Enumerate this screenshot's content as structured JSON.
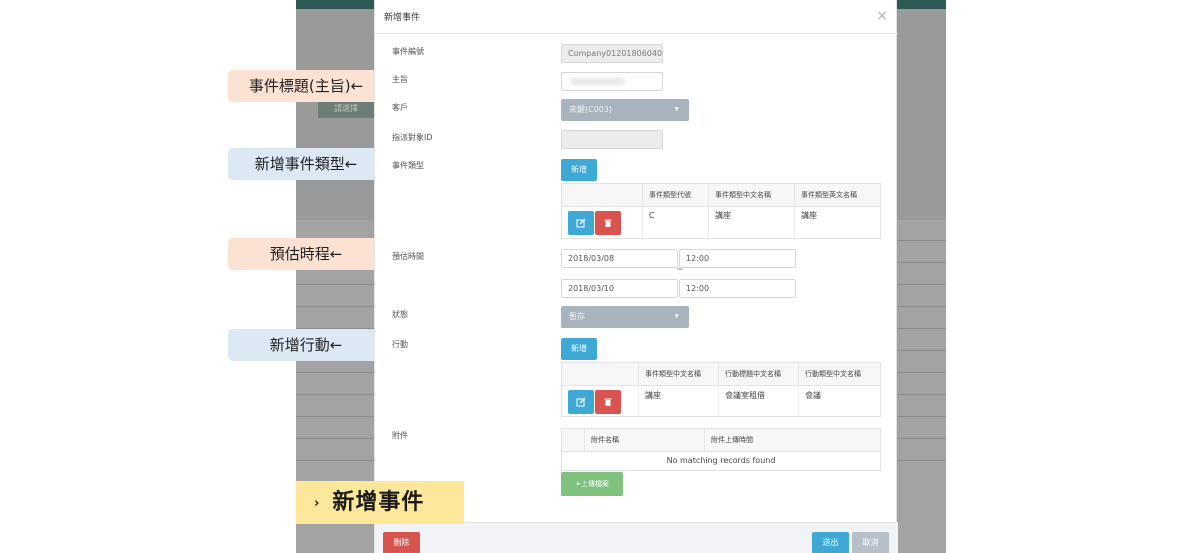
{
  "background": {
    "button_label": "請選擇"
  },
  "callouts": {
    "subject": "事件標題(主旨)←",
    "event_type": "新增事件類型←",
    "estimated_time": "預估時程←",
    "action": "新增行動←"
  },
  "banner": {
    "chevron": "›",
    "text": "新增事件"
  },
  "modal": {
    "title": "新增事件",
    "close_glyph": "×",
    "fields": {
      "event_number_label": "事件編號",
      "event_number_value": "Company01201806040",
      "subject_label": "主旨",
      "customer_label": "客戶",
      "customer_value": "來鍵(C003)",
      "assignee_label": "指派對象ID",
      "event_type_label": "事件類型",
      "estimated_time_label": "預估時間",
      "start_date": "2018/03/08",
      "start_time": "12:00",
      "separator": "~",
      "end_date": "2018/03/10",
      "end_time": "12:00",
      "status_label": "狀態",
      "status_value": "暫存",
      "action_label": "行動",
      "attachment_label": "附件"
    },
    "add_label": "新增",
    "event_type_table": {
      "headers": [
        "事件類型代號",
        "事件類型中文名稱",
        "事件類型英文名稱"
      ],
      "rows": [
        [
          "C",
          "講座",
          "講座"
        ]
      ]
    },
    "action_table": {
      "headers": [
        "事件類型中文名稱",
        "行動標題中文名稱",
        "行動類型中文名稱"
      ],
      "rows": [
        [
          "講座",
          "會議室租借",
          "會議"
        ]
      ]
    },
    "attachment_table": {
      "headers": [
        "附件名稱",
        "附件上傳時間"
      ],
      "empty_text": "No matching records found"
    },
    "upload_label": "+上傳檔案",
    "footer": {
      "delete_label": "刪除",
      "submit_label": "送出",
      "cancel_label": "取消"
    }
  },
  "colors": {
    "primary": "#3fa9d6",
    "danger": "#d9534f",
    "success": "#7ec27e",
    "banner": "#fde79a"
  }
}
